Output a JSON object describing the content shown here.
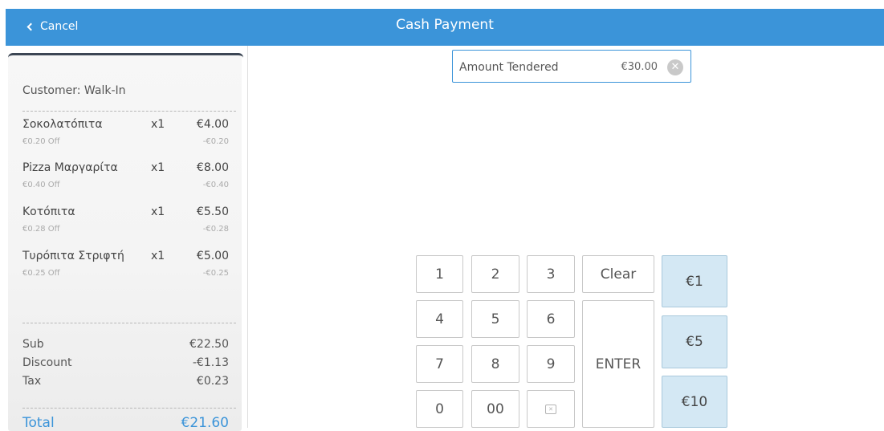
{
  "header": {
    "cancel_label": "Cancel",
    "title": "Cash Payment"
  },
  "receipt": {
    "customer": "Customer: Walk-In",
    "items": [
      {
        "name": "Σοκολατόπιτα",
        "qty": "x1",
        "price": "€4.00",
        "discount_label": "€0.20 Off",
        "discount_value": "-€0.20"
      },
      {
        "name": "Pizza Μαργαρίτα",
        "qty": "x1",
        "price": "€8.00",
        "discount_label": "€0.40 Off",
        "discount_value": "-€0.40"
      },
      {
        "name": "Κοτόπιτα",
        "qty": "x1",
        "price": "€5.50",
        "discount_label": "€0.28 Off",
        "discount_value": "-€0.28"
      },
      {
        "name": "Τυρόπιτα Στριφτή",
        "qty": "x1",
        "price": "€5.00",
        "discount_label": "€0.25 Off",
        "discount_value": "-€0.25"
      }
    ],
    "summary": {
      "sub_label": "Sub",
      "sub_value": "€22.50",
      "discount_label": "Discount",
      "discount_value": "-€1.13",
      "tax_label": "Tax",
      "tax_value": "€0.23"
    },
    "total": {
      "label": "Total",
      "value": "€21.60"
    }
  },
  "amount_tendered": {
    "label": "Amount Tendered",
    "value": "€30.00",
    "clear_icon": "close-circle-icon"
  },
  "keypad": {
    "keys": [
      "1",
      "2",
      "3",
      "4",
      "5",
      "6",
      "7",
      "8",
      "9",
      "0",
      "00"
    ],
    "clear_label": "Clear",
    "enter_label": "ENTER",
    "backspace_icon": "backspace-icon",
    "quick_cash": [
      "€1",
      "€5",
      "€10"
    ]
  },
  "colors": {
    "accent": "#3b94d9",
    "quick_cash_bg": "#d4e8f4"
  }
}
